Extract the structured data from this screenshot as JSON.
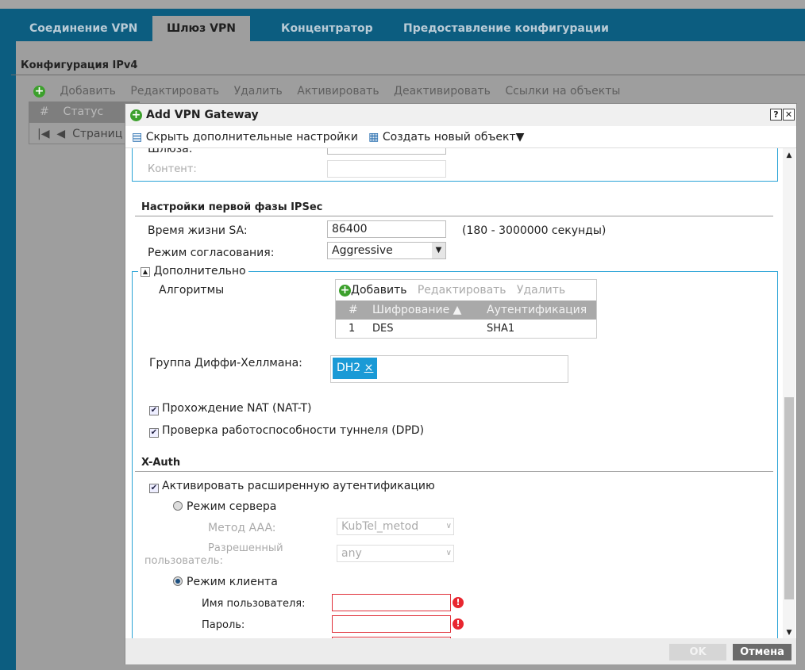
{
  "tabs": [
    {
      "label": "Соединение VPN"
    },
    {
      "label": "Шлюз VPN"
    },
    {
      "label": "Концентратор"
    },
    {
      "label": "Предоставление конфигурации"
    }
  ],
  "background": {
    "section_title": "Конфигурация IPv4",
    "toolbar": [
      "Добавить",
      "Редактировать",
      "Удалить",
      "Активировать",
      "Деактивировать",
      "Ссылки на объекты"
    ],
    "table_headers": [
      "#",
      "Статус"
    ],
    "pager_label": "Страниц"
  },
  "modal": {
    "title": "Add VPN Gateway",
    "help": "?",
    "close": "✕",
    "toolbar": {
      "hide_advanced": "Скрыть дополнительные настройки",
      "create_object": "Создать новый объект▼"
    },
    "top_partial": {
      "gateway_label": "Шлюза:",
      "content_label": "Контент:",
      "content_value": ""
    },
    "phase1": {
      "title": "Настройки первой фазы IPSec",
      "sa_lifetime_label": "Время жизни SA:",
      "sa_lifetime_value": "86400",
      "sa_lifetime_hint": "(180 - 3000000 секунды)",
      "negotiation_label": "Режим согласования:",
      "negotiation_value": "Aggressive"
    },
    "advanced": {
      "legend": "Дополнительно",
      "algorithms_label": "Алгоритмы",
      "alg_toolbar": [
        "Добавить",
        "Редактировать",
        "Удалить"
      ],
      "alg_headers": [
        "#",
        "Шифрование ▲",
        "Аутентификация"
      ],
      "alg_rows": [
        [
          "1",
          "DES",
          "SHA1"
        ]
      ],
      "dh_label": "Группа Диффи-Хеллмана:",
      "dh_tags": [
        "DH2"
      ],
      "tag_remove": "×",
      "nat_t": {
        "label": "Прохождение NAT (NAT-T)",
        "checked": true
      },
      "dpd": {
        "label": "Проверка работоспособности туннеля (DPD)",
        "checked": true
      }
    },
    "xauth": {
      "title": "X-Auth",
      "enable": {
        "label": "Активировать расширенную аутентификацию",
        "checked": true
      },
      "server_mode": "Режим сервера",
      "aaa_label": "Метод AAA:",
      "aaa_value": "KubTel_metod",
      "allowed_user_label_1": "Разрешенный",
      "allowed_user_label_2": "пользователь:",
      "allowed_user_value": "any",
      "client_mode": "Режим клиента",
      "username_label": "Имя пользователя:",
      "username_value": "",
      "password_label": "Пароль:",
      "password_value": "",
      "error_icon": "!"
    },
    "buttons": {
      "ok": "OK",
      "cancel": "Отмена"
    }
  }
}
